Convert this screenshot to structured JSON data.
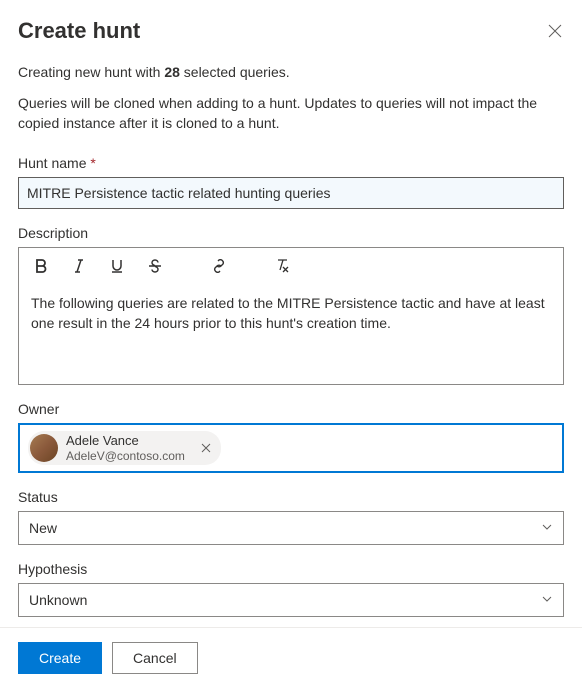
{
  "header": {
    "title": "Create hunt"
  },
  "intro": {
    "prefix": "Creating new hunt with ",
    "count": "28",
    "suffix": " selected queries."
  },
  "info_text": "Queries will be cloned when adding to a hunt. Updates to queries will not impact the copied instance after it is cloned to a hunt.",
  "fields": {
    "hunt_name": {
      "label": "Hunt name",
      "required_mark": "*",
      "value": "MITRE Persistence tactic related hunting queries"
    },
    "description": {
      "label": "Description",
      "content": "The following queries are related to the MITRE Persistence tactic and have at least one result in the 24 hours prior to this hunt's creation time."
    },
    "owner": {
      "label": "Owner",
      "persona_name": "Adele Vance",
      "persona_email": "AdeleV@contoso.com"
    },
    "status": {
      "label": "Status",
      "value": "New"
    },
    "hypothesis": {
      "label": "Hypothesis",
      "value": "Unknown"
    }
  },
  "footer": {
    "create": "Create",
    "cancel": "Cancel"
  }
}
